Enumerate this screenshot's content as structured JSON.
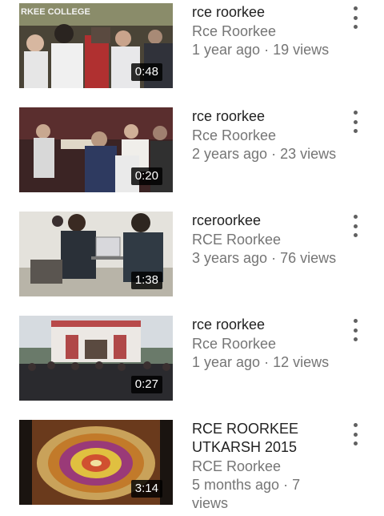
{
  "videos": [
    {
      "title": "rce roorkee",
      "channel": "Rce Roorkee",
      "age": "1 year ago",
      "views": "19 views",
      "duration": "0:48",
      "thumb_banner": "RKEE COLLEGE"
    },
    {
      "title": "rce roorkee",
      "channel": "Rce Roorkee",
      "age": "2 years ago",
      "views": "23 views",
      "duration": "0:20"
    },
    {
      "title": "rceroorkee",
      "channel": "RCE Roorkee",
      "age": "3 years ago",
      "views": "76 views",
      "duration": "1:38"
    },
    {
      "title": "rce roorkee",
      "channel": "Rce Roorkee",
      "age": "1 year ago",
      "views": "12 views",
      "duration": "0:27"
    },
    {
      "title": "RCE ROORKEE UTKARSH 2015",
      "channel": "RCE Roorkee",
      "age": "5 months ago",
      "views": "7 views",
      "duration": "3:14"
    }
  ],
  "icons": {
    "more": "more-vert-icon"
  },
  "separator": " · "
}
